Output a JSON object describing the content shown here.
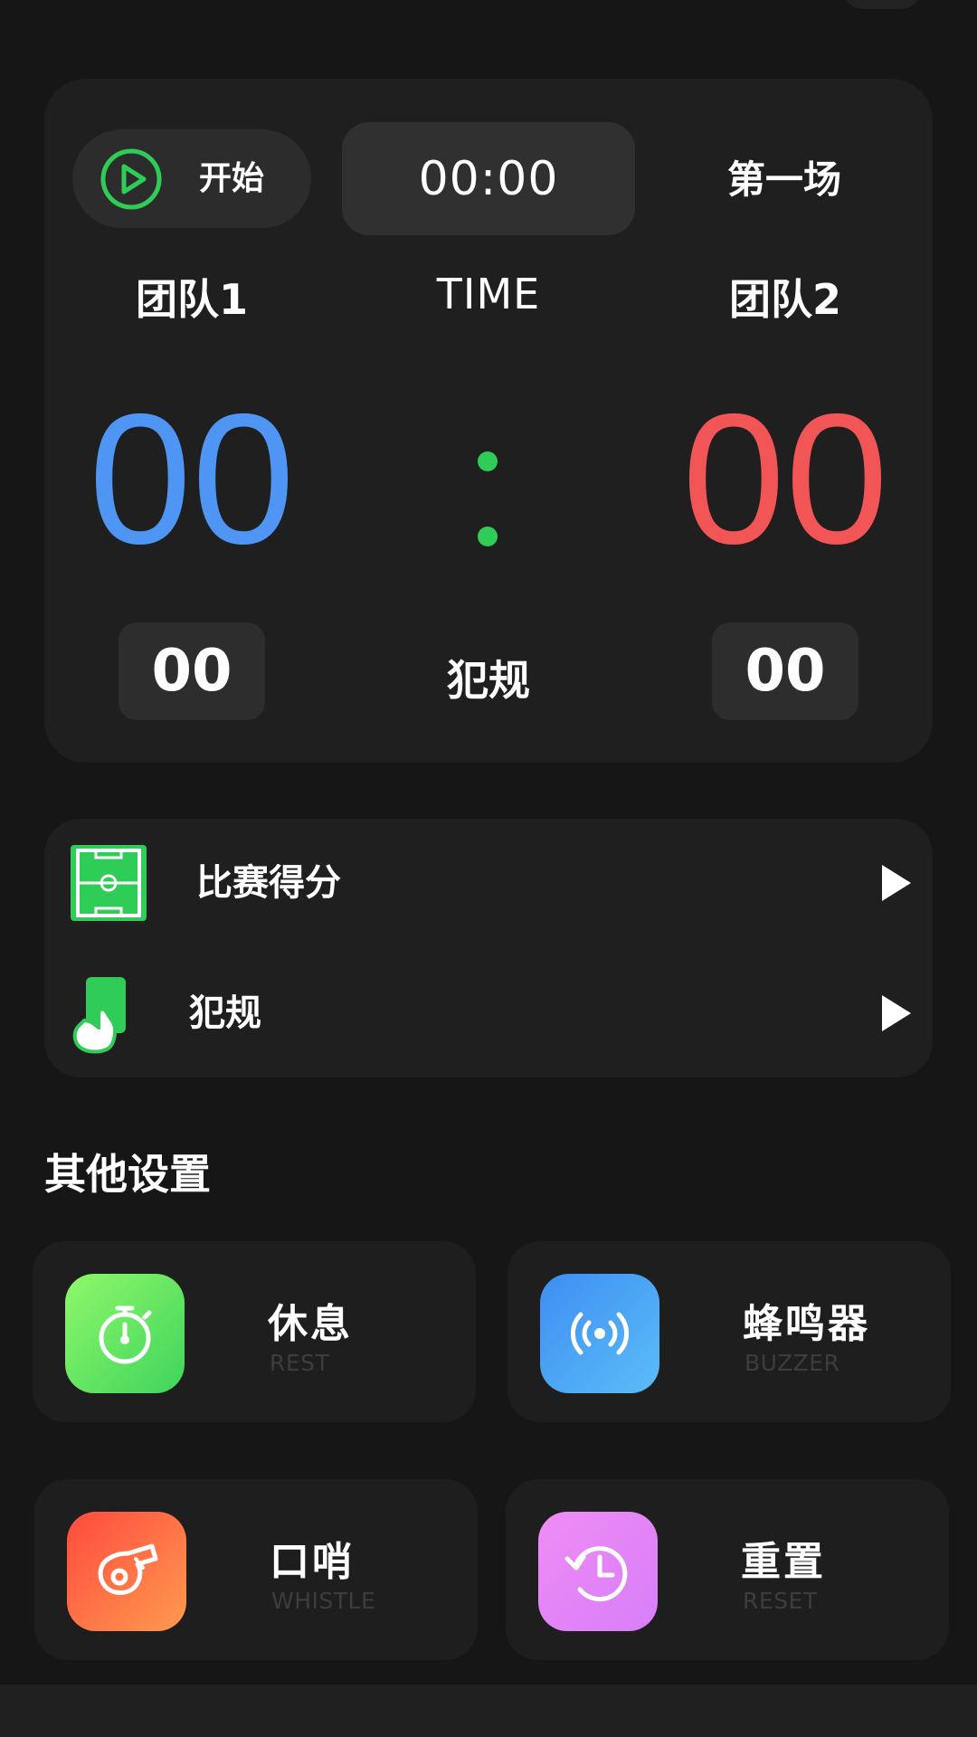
{
  "scoreboard": {
    "start_label": "开始",
    "timer": "00:00",
    "round": "第一场",
    "team1_name": "团队1",
    "team2_name": "团队2",
    "time_label": "TIME",
    "team1_score": "00",
    "team2_score": "00",
    "team1_fouls": "00",
    "team2_fouls": "00",
    "fouls_label": "犯规"
  },
  "menu": {
    "items": [
      {
        "label": "比赛得分",
        "icon": "soccer-field-icon"
      },
      {
        "label": "犯规",
        "icon": "foul-card-icon"
      }
    ]
  },
  "other_settings": {
    "title": "其他设置",
    "tiles": [
      {
        "title": "休息",
        "subtitle": "REST",
        "icon": "stopwatch-icon"
      },
      {
        "title": "蜂鸣器",
        "subtitle": "BUZZER",
        "icon": "buzzer-icon"
      },
      {
        "title": "口哨",
        "subtitle": "WHISTLE",
        "icon": "whistle-icon"
      },
      {
        "title": "重置",
        "subtitle": "RESET",
        "icon": "reset-clock-icon"
      }
    ]
  },
  "colors": {
    "accent_green": "#2fcc58",
    "team1_blue": "#4f95f3",
    "team2_red": "#f25555"
  }
}
